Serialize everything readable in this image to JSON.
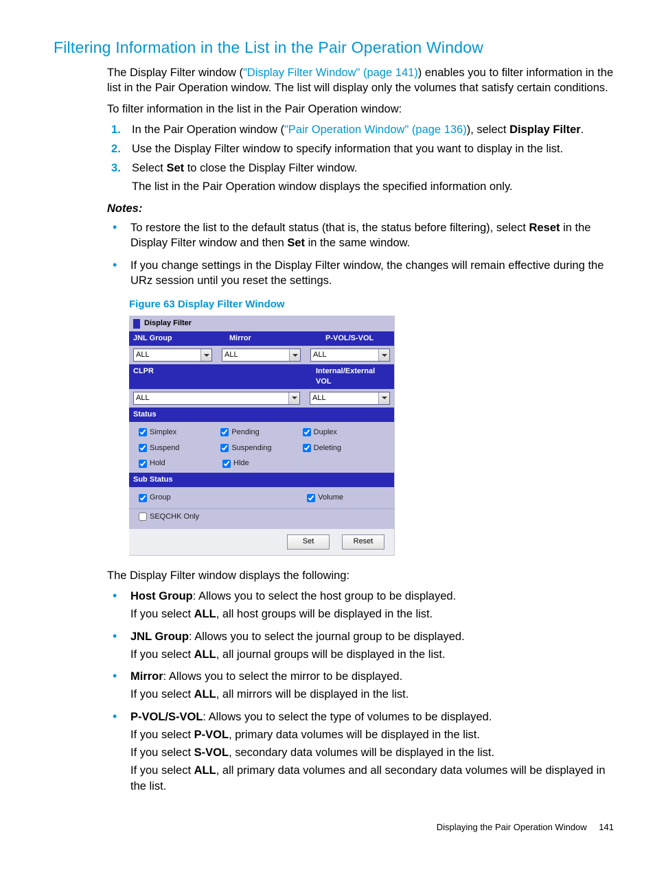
{
  "title": "Filtering Information in the List in the Pair Operation Window",
  "intro": {
    "t1a": "The Display Filter window (",
    "link1": "\"Display Filter Window\" (page 141)",
    "t1b": ") enables you to filter information in the list in the Pair Operation window. The list will display only the volumes that satisfy certain conditions.",
    "t2": "To filter information in the list in the Pair Operation window:"
  },
  "steps": {
    "s1a": "In the Pair Operation window (",
    "s1link": "\"Pair Operation Window\" (page 136)",
    "s1b": "), select ",
    "s1c": "Display Filter",
    "s1d": ".",
    "s2": "Use the Display Filter window to specify information that you want to display in the list.",
    "s3a": "Select ",
    "s3b": "Set",
    "s3c": " to close the Display Filter window.",
    "s3sub": "The list in the Pair Operation window displays the specified information only."
  },
  "notes": {
    "head": "Notes:",
    "n1a": "To restore the list to the default status (that is, the status before filtering), select ",
    "n1b": "Reset",
    "n1c": " in the Display Filter window and then ",
    "n1d": "Set",
    "n1e": " in the same window.",
    "n2": "If you change settings in the Display Filter window, the changes will remain effective during the URz session until you reset the settings."
  },
  "figure": {
    "caption": "Figure 63 Display Filter Window"
  },
  "dialog": {
    "title": "Display Filter",
    "labels": {
      "jnl": "JNL Group",
      "mirror": "Mirror",
      "pvol": "P-VOL/S-VOL",
      "clpr": "CLPR",
      "intext": "Internal/External VOL",
      "status": "Status",
      "substatus": "Sub Status"
    },
    "values": {
      "jnl": "ALL",
      "mirror": "ALL",
      "pvol": "ALL",
      "clpr": "ALL",
      "intext": "ALL"
    },
    "checks": {
      "simplex": "Simplex",
      "pending": "Pending",
      "duplex": "Duplex",
      "suspend": "Suspend",
      "suspending": "Suspending",
      "deleting": "Deleting",
      "hold": "Hold",
      "hlde": "Hlde",
      "group": "Group",
      "volume": "Volume",
      "seqchk": "SEQCHK Only"
    },
    "buttons": {
      "set": "Set",
      "reset": "Reset"
    }
  },
  "after": "The Display Filter window displays the following:",
  "desc": {
    "host_t": "Host Group",
    "host_a": ": Allows you to select the host group to be displayed.",
    "host_b1": "If you select ",
    "host_b2": "ALL",
    "host_b3": ", all host groups will be displayed in the list.",
    "jnl_t": "JNL Group",
    "jnl_a": ": Allows you to select the journal group to be displayed.",
    "jnl_b1": "If you select ",
    "jnl_b2": "ALL",
    "jnl_b3": ", all journal groups will be displayed in the list.",
    "mir_t": "Mirror",
    "mir_a": ": Allows you to select the mirror to be displayed.",
    "mir_b1": "If you select ",
    "mir_b2": "ALL",
    "mir_b3": ", all mirrors will be displayed in the list.",
    "pv_t": "P-VOL/S-VOL",
    "pv_a": ": Allows you to select the type of volumes to be displayed.",
    "pv_b1": "If you select ",
    "pv_b2": "P-VOL",
    "pv_b3": ", primary data volumes will be displayed in the list.",
    "pv_c1": "If you select ",
    "pv_c2": "S-VOL",
    "pv_c3": ", secondary data volumes will be displayed in the list.",
    "pv_d1": "If you select ",
    "pv_d2": "ALL",
    "pv_d3": ", all primary data volumes and all secondary data volumes will be displayed in the list."
  },
  "footer": {
    "text": "Displaying the Pair Operation Window",
    "page": "141"
  }
}
